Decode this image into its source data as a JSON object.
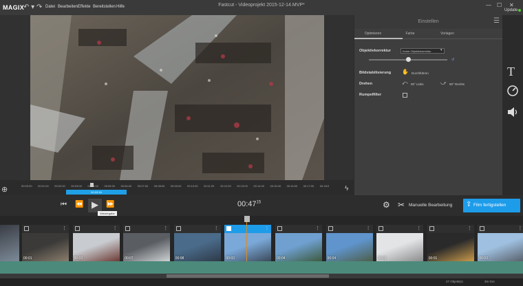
{
  "app": {
    "logo": "MAGIX",
    "title": "Fastcut - Videoprojekt 2015-12-14.MVP*",
    "update_label": "Update"
  },
  "menu": [
    "Datei",
    "Bearbeiten",
    "Effekte",
    "Bereitstellen",
    "Hilfe"
  ],
  "panel": {
    "title": "Einstellen",
    "tabs": [
      "Optimieren",
      "Farbe",
      "Vorlagen"
    ],
    "active_tab": "Optimieren",
    "objektiv_label": "Objektivkorrektur",
    "objektiv_value": "Keine Objektivkorrektur",
    "objektiv_slider_value": 0.5,
    "stabil_label": "Bildstabilisierung",
    "stabil_action": "Durchführen",
    "drehen_label": "Drehen",
    "drehen_left": "90° Links",
    "drehen_right": "90° Rechts",
    "rumpel_label": "Rumpelfilter"
  },
  "ruler": {
    "ticks": [
      "00:00:00",
      "00:01:00",
      "00:02:00",
      "00:03:00",
      "00:04:00",
      "00:05:00",
      "00:06:00",
      "00:07:00",
      "00:08:00",
      "00:09:00",
      "00:10:00",
      "00:11:00",
      "00:12:00",
      "00:13:00",
      "00:14:00",
      "00:15:00",
      "00:16:00",
      "00:17:00",
      "00:18:0"
    ],
    "range_label": "00:03:18"
  },
  "transport": {
    "timecode_main": "00:47",
    "timecode_frames": "15",
    "tooltip": "Wiedergabe",
    "manual_label": "Manuelle Bearbeitung",
    "finish_label": "Film fertigstellen"
  },
  "clips": [
    {
      "label": "00:01",
      "selected": false
    },
    {
      "label": "00:03",
      "selected": false
    },
    {
      "label": "00:07",
      "selected": false
    },
    {
      "label": "00:08",
      "selected": false
    },
    {
      "label": "00:03",
      "selected": true
    },
    {
      "label": "00:04",
      "selected": false
    },
    {
      "label": "00:04",
      "selected": false
    },
    {
      "label": "00:01",
      "selected": false
    },
    {
      "label": "00:01",
      "selected": false
    },
    {
      "label": "00:03",
      "selected": false
    }
  ],
  "status": {
    "objects": "27 Objekt(e)",
    "duration": "3m 01s"
  },
  "colors": {
    "accent": "#1d9cea",
    "playhead": "#e38b1c",
    "track": "#4c8a7b"
  }
}
